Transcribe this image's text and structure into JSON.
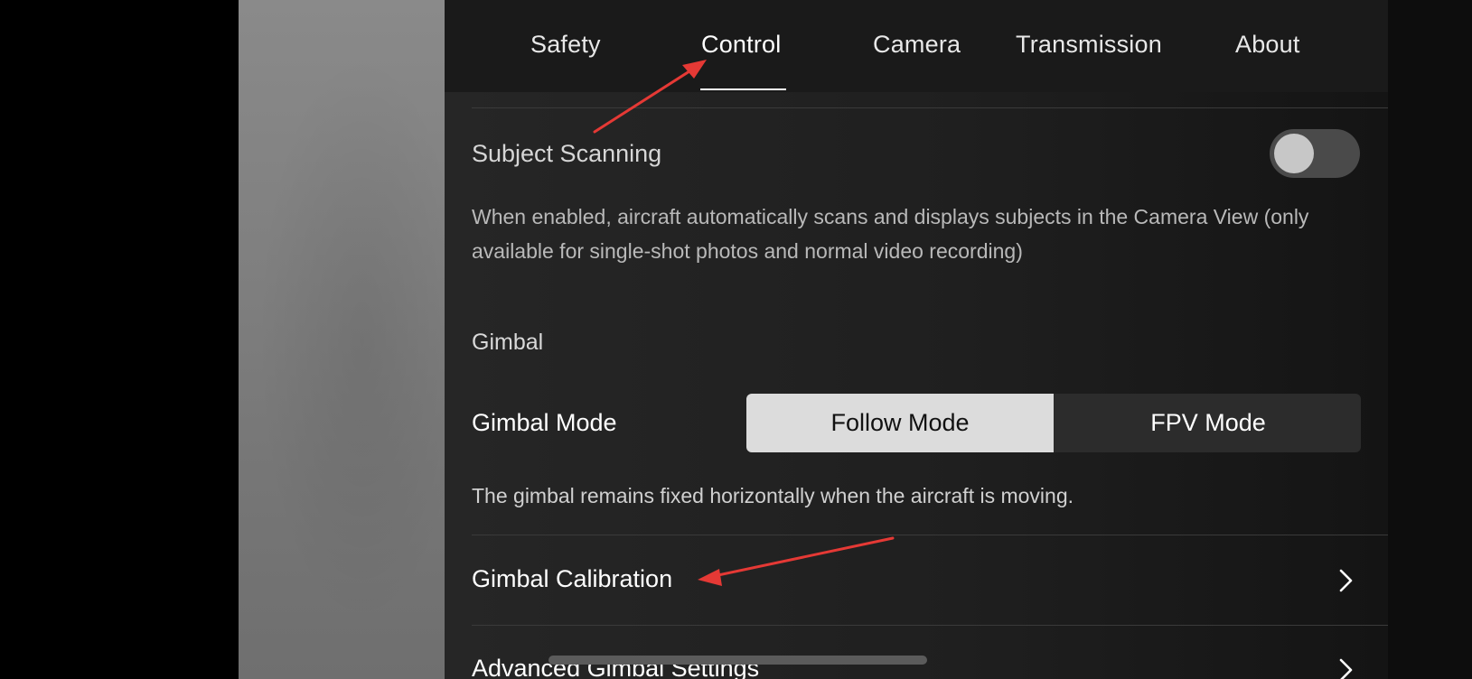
{
  "tabs": [
    "Safety",
    "Control",
    "Camera",
    "Transmission",
    "About"
  ],
  "active_tab": "Control",
  "subject_scanning": {
    "label": "Subject Scanning",
    "enabled": false,
    "description_line1": "When enabled, aircraft automatically scans and displays subjects in the Camera View (only",
    "description_line2": "available for single-shot photos and normal video recording)"
  },
  "gimbal_section": {
    "title": "Gimbal",
    "mode_label": "Gimbal Mode",
    "modes": [
      "Follow Mode",
      "FPV Mode"
    ],
    "selected_mode": "Follow Mode",
    "mode_description": "The gimbal remains fixed horizontally when the aircraft is moving.",
    "calibration_label": "Gimbal Calibration",
    "advanced_label": "Advanced Gimbal Settings"
  },
  "icons": {
    "chevron": "chevron-right-icon",
    "annotation": "red-arrow-annotation"
  },
  "colors": {
    "annotation_red": "#e53935",
    "toggle_off": "#4a4a4a",
    "selected_segment": "#dcdcdc"
  }
}
